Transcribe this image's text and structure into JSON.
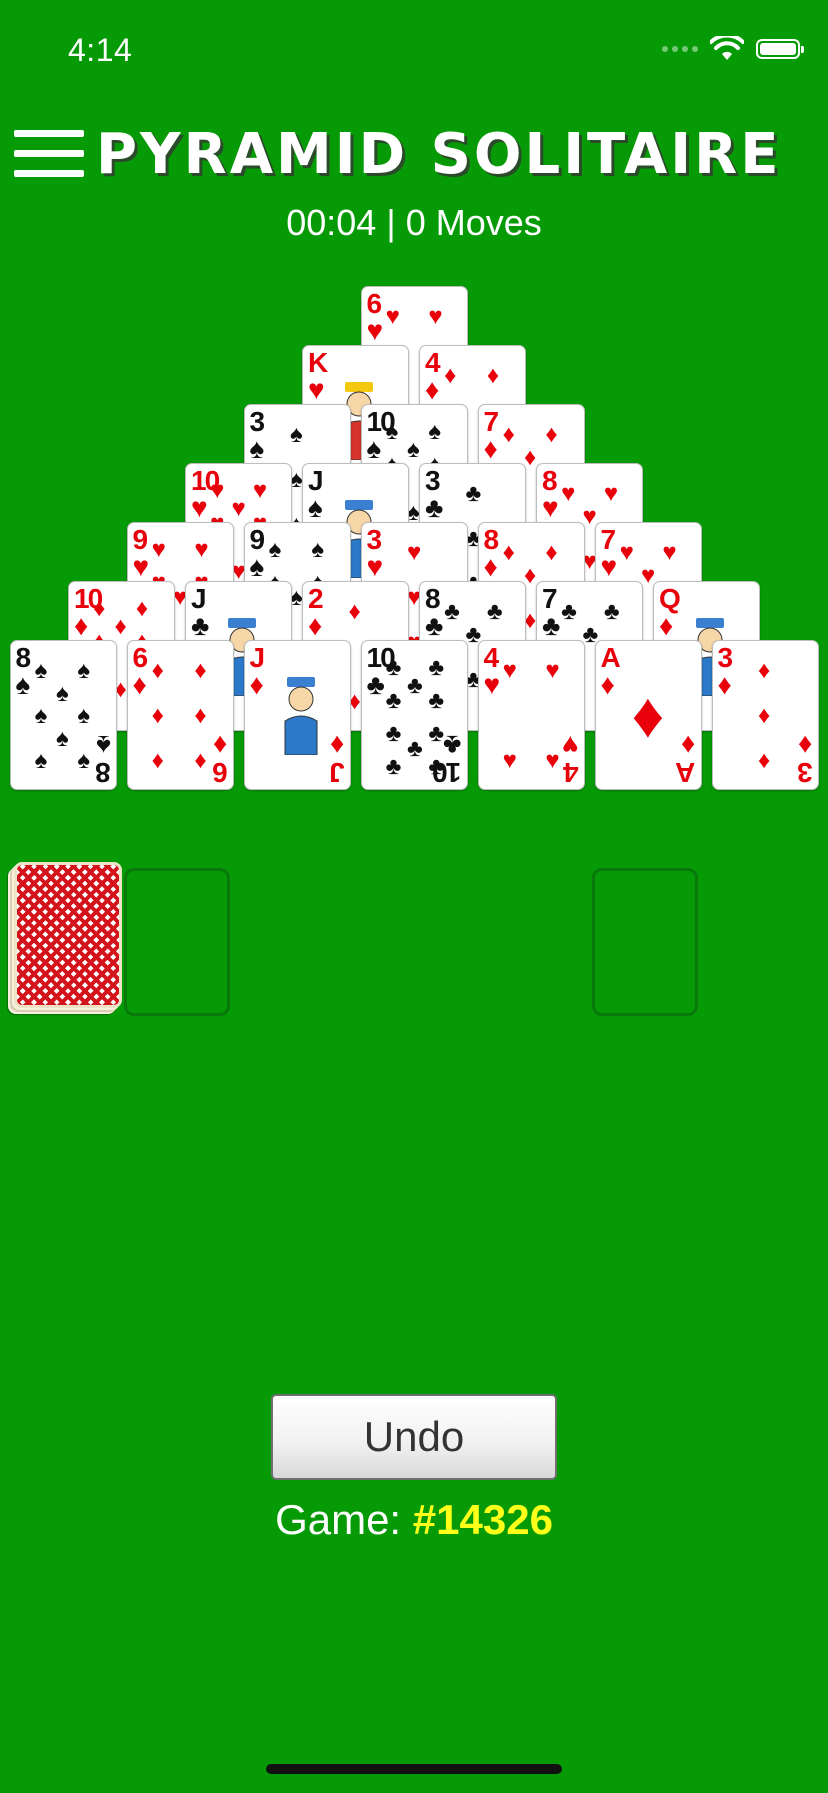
{
  "status_bar": {
    "time": "4:14"
  },
  "header": {
    "title": "PYRAMID SOLITAIRE",
    "timer": "00:04",
    "separator": " | ",
    "moves": "0 Moves"
  },
  "pyramid": [
    [
      "6♥"
    ],
    [
      "K♥",
      "4♦"
    ],
    [
      "3♠",
      "10♠",
      "7♦"
    ],
    [
      "10♥",
      "J♠",
      "3♣",
      "8♥"
    ],
    [
      "9♥",
      "9♠",
      "3♥",
      "8♦",
      "7♥"
    ],
    [
      "10♦",
      "J♣",
      "2♦",
      "8♣",
      "7♣",
      "Q♦"
    ],
    [
      "8♠",
      "6♦",
      "J♦",
      "10♣",
      "4♥",
      "A♦",
      "3♦"
    ]
  ],
  "stock": {
    "face": "down"
  },
  "waste": {
    "card": null
  },
  "foundation": {
    "card": null
  },
  "controls": {
    "undo_label": "Undo"
  },
  "footer": {
    "game_label": "Game: ",
    "game_number": "#14326"
  },
  "colors": {
    "felt": "#069b06",
    "red_suit": "#e8000b",
    "game_number": "#ffff1a"
  }
}
